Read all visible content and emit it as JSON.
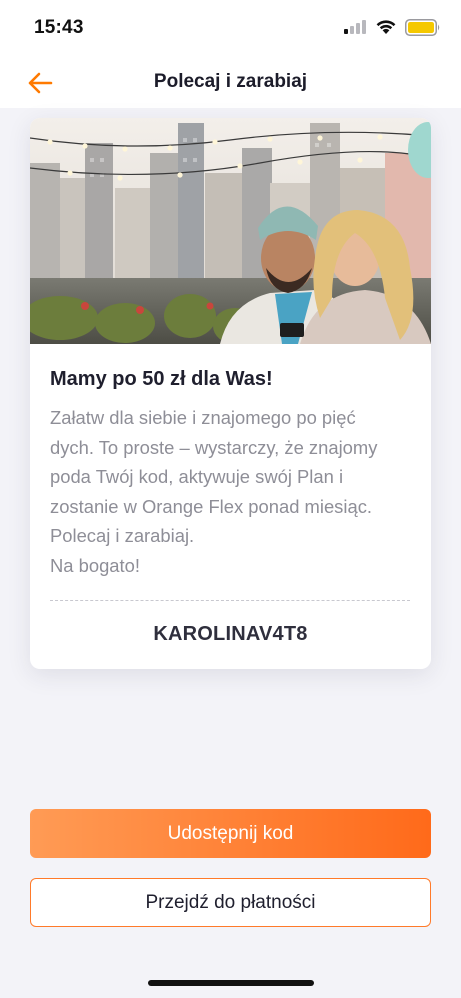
{
  "status_bar": {
    "time": "15:43",
    "icons": [
      "signal-icon",
      "wifi-icon",
      "battery-icon"
    ],
    "battery_color": "#f5c800"
  },
  "nav": {
    "title": "Polecaj i zarabiaj",
    "back_icon": "arrow-left-icon",
    "accent_color": "#ff7a00"
  },
  "card": {
    "image_description": "photo-couple-rooftop",
    "title": "Mamy po 50 zł dla Was!",
    "body_lines": [
      "Załatw dla siebie i znajomego po pięć",
      "dych. To proste – wystarczy, że znajomy",
      "poda Twój kod, aktywuje swój Plan i",
      "zostanie w Orange Flex ponad miesiąc.",
      "Polecaj i zarabiaj.",
      "Na bogato!"
    ],
    "code": "KAROLINAV4T8"
  },
  "actions": {
    "share_label": "Udostępnij kod",
    "payment_label": "Przejdź do płatności"
  }
}
